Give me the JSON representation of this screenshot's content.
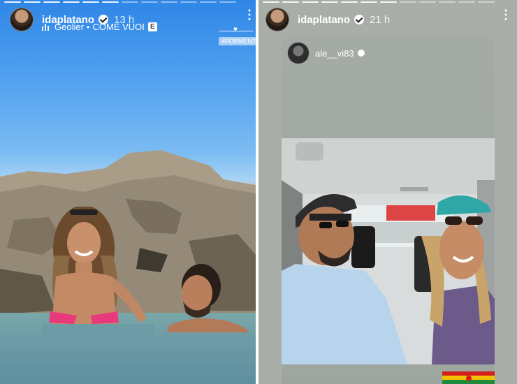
{
  "left_story": {
    "progress_segments": 12,
    "progress_active_index": 5,
    "username": "idaplatano",
    "time": "13 h",
    "music_artist": "Geolier",
    "music_separator": "•",
    "music_title": "COME VUOI",
    "music_explicit_badge": "E",
    "location_tag": "#FORMENTERA",
    "more_icon": "more-vertical-icon"
  },
  "right_story": {
    "progress_segments": 12,
    "progress_active_index": 6,
    "username": "idaplatano",
    "time": "21 h",
    "more_icon": "more-vertical-icon",
    "reposted_username": "ale__vi83"
  },
  "colors": {
    "sky_top": "#2f86e6",
    "sea": "#6d9ba6",
    "right_background": "#a9aea8",
    "text": "#ffffff",
    "flag_red": "#d21f1f",
    "flag_yellow": "#f2c200",
    "flag_green": "#1e8a3c"
  }
}
